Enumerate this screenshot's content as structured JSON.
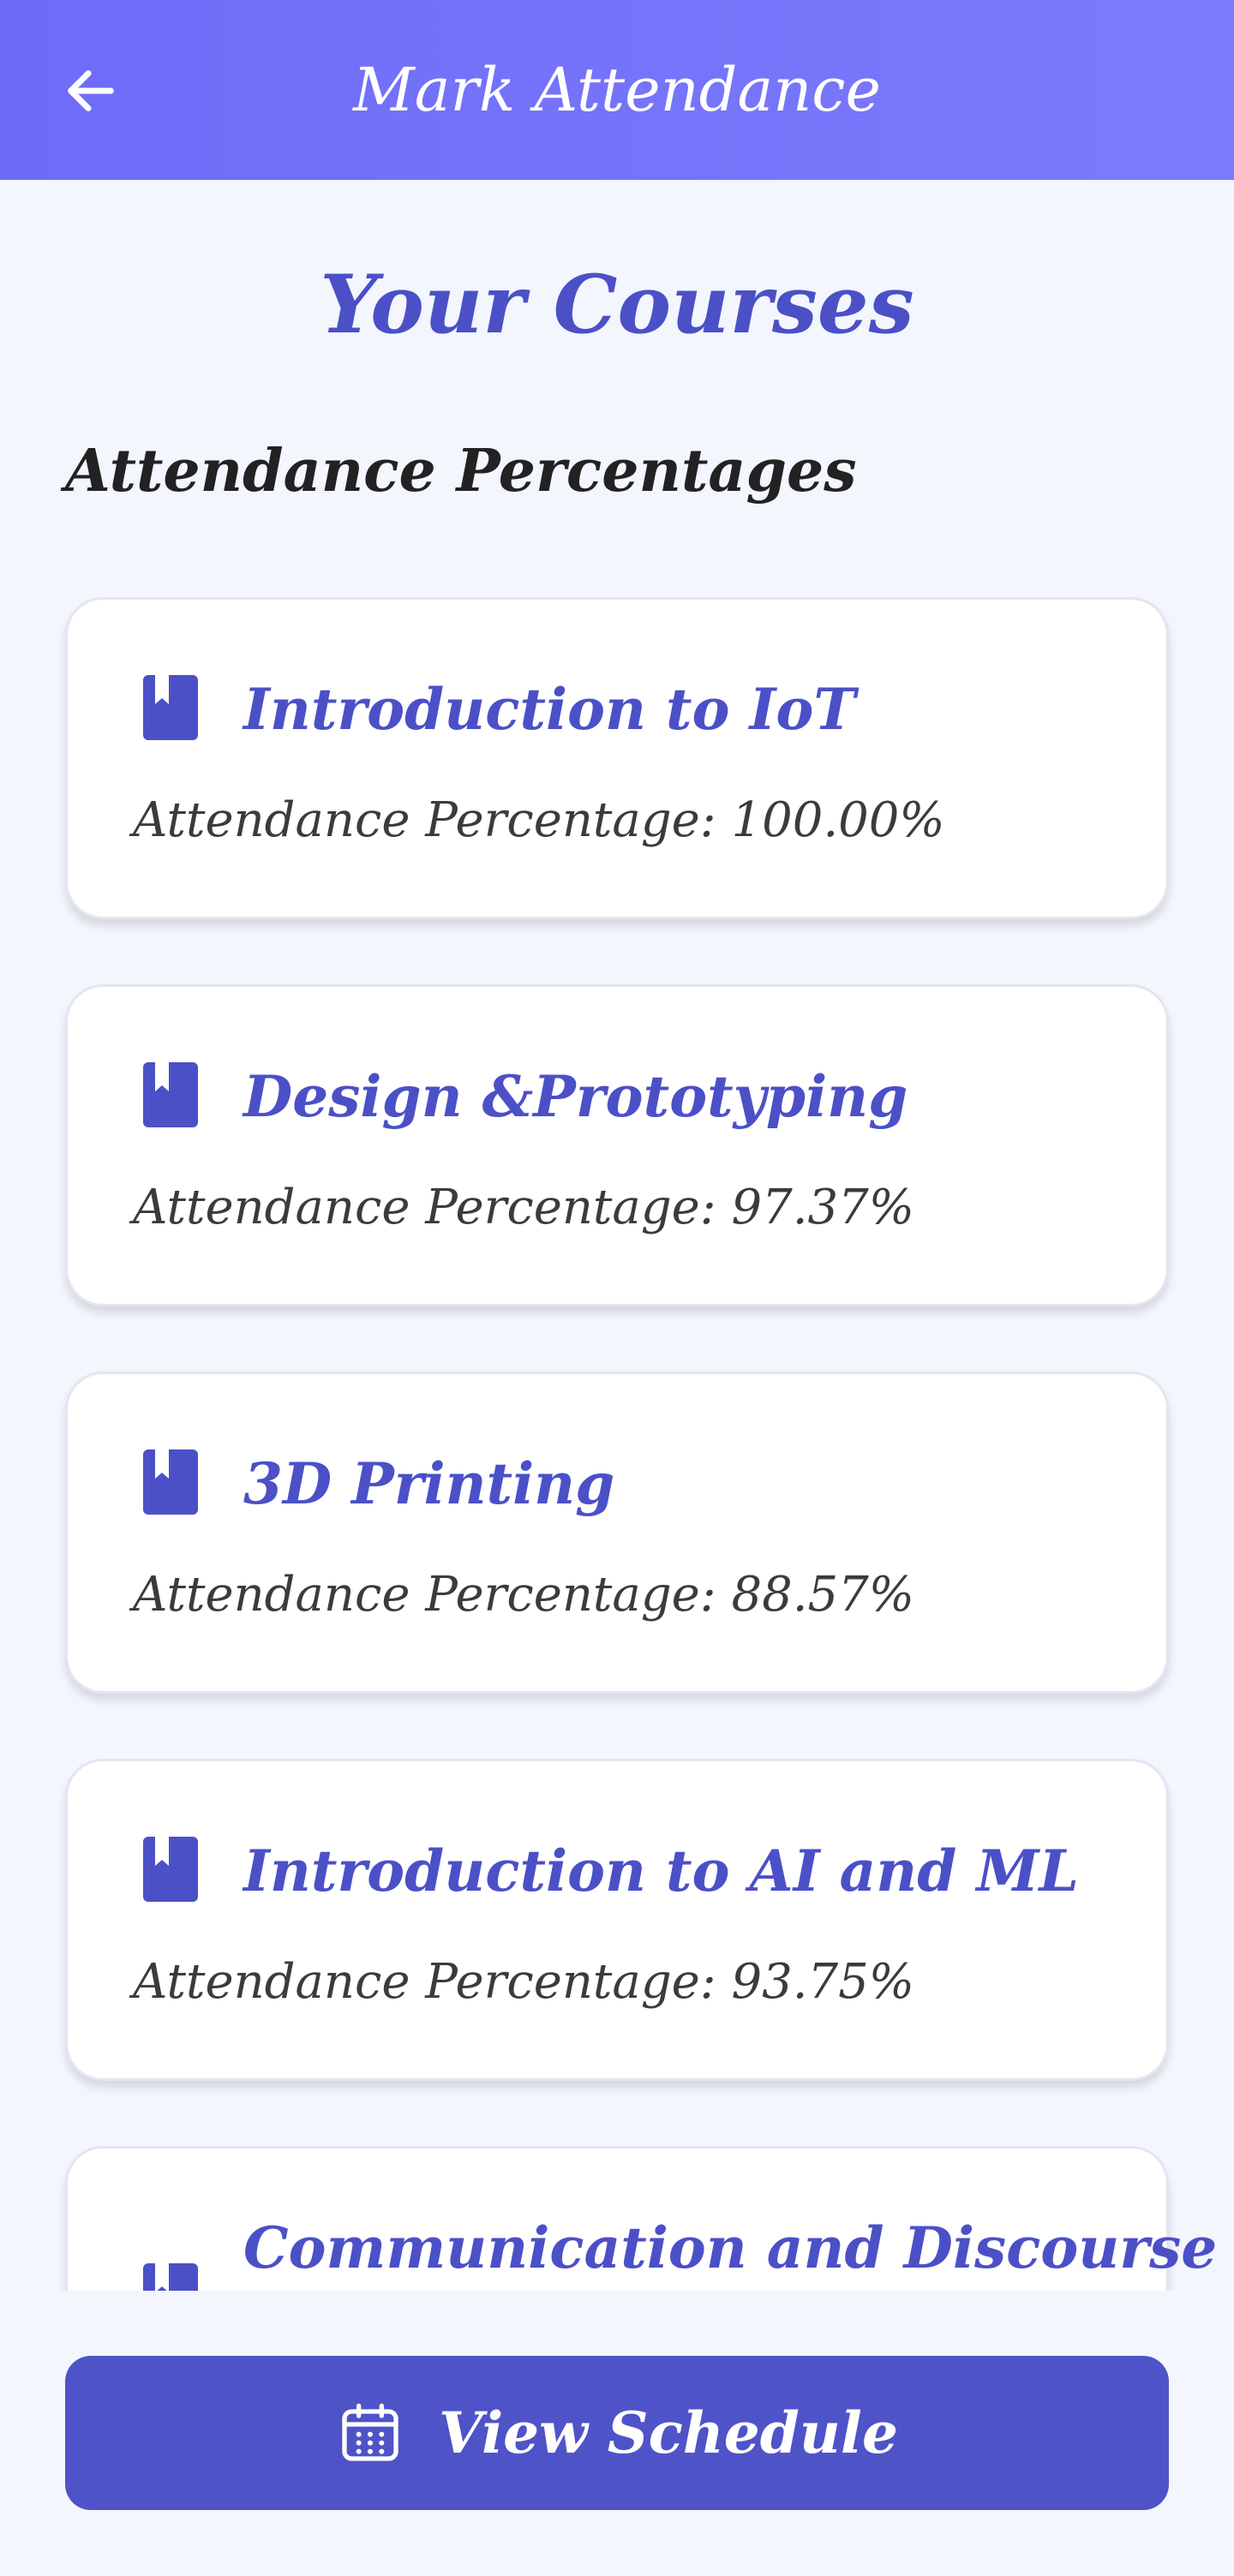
{
  "header": {
    "title": "Mark Attendance",
    "back_icon": "arrow-left-icon",
    "gradient_start": "#6e6cf7",
    "gradient_end": "#7b7bfd"
  },
  "page": {
    "title": "Your Courses",
    "section_title": "Attendance Percentages"
  },
  "courses": [
    {
      "name": "Introduction to IoT",
      "attendance_text": "Attendance Percentage: 100.00%",
      "icon": "book-icon"
    },
    {
      "name": "Design &Prototyping",
      "attendance_text": "Attendance Percentage: 97.37%",
      "icon": "book-icon"
    },
    {
      "name": "3D Printing",
      "attendance_text": "Attendance Percentage: 88.57%",
      "icon": "book-icon"
    },
    {
      "name": "Introduction to AI and ML",
      "attendance_text": "Attendance Percentage: 93.75%",
      "icon": "book-icon"
    },
    {
      "name": "Communication and Discourse",
      "attendance_text": "",
      "icon": "book-icon"
    }
  ],
  "footer": {
    "button_label": "View Schedule",
    "button_icon": "calendar-icon"
  },
  "colors": {
    "accent": "#4b50c7",
    "button": "#4f53c8",
    "background": "#f3f6fd"
  }
}
